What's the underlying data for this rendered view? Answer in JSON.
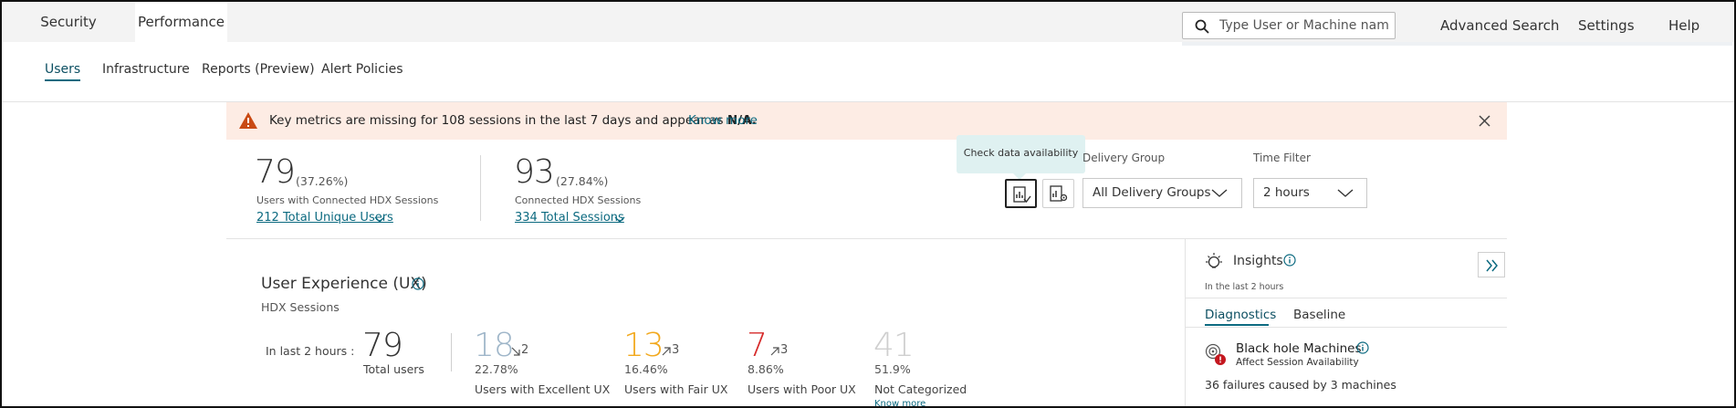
{
  "top_tabs": [
    {
      "label": "Security",
      "active": false
    },
    {
      "label": "Performance",
      "active": true
    }
  ],
  "search": {
    "placeholder": "Type User or Machine name"
  },
  "top_links": {
    "advanced_search": "Advanced Search",
    "settings": "Settings",
    "help": "Help"
  },
  "subnav": [
    {
      "label": "Users",
      "active": true
    },
    {
      "label": "Infrastructure",
      "active": false
    },
    {
      "label": "Reports (Preview)",
      "active": false
    },
    {
      "label": "Alert Policies",
      "active": false
    }
  ],
  "alert": {
    "text_before": "Key metrics are missing for 108 sessions in the last 7 days and appear as ",
    "text_bold": "N/A.",
    "link": "Know more",
    "icon": "warning-icon",
    "color": "#fdece4"
  },
  "stats": {
    "users": {
      "value": "79",
      "pct": "(37.26%)",
      "label": "Users with Connected HDX Sessions",
      "link": "212 Total Unique Users"
    },
    "sessions": {
      "value": "93",
      "pct": "(27.84%)",
      "label": "Connected HDX Sessions",
      "link": "334 Total Sessions"
    }
  },
  "tooltip": "Check data availability",
  "filters": {
    "delivery_group": {
      "label": "Delivery Group",
      "value": "All Delivery Groups"
    },
    "time_filter": {
      "label": "Time Filter",
      "value": "2 hours"
    }
  },
  "ux": {
    "title": "User Experience (UX)",
    "subtitle": "HDX Sessions",
    "period_label": "In last 2 hours :",
    "total": {
      "value": "79",
      "label": "Total users"
    },
    "excellent": {
      "value": "18",
      "delta": "2",
      "pct": "22.78%",
      "label": "Users with Excellent UX",
      "color": "#9fb6c9"
    },
    "fair": {
      "value": "13",
      "delta": "3",
      "pct": "16.46%",
      "label": "Users with Fair UX",
      "color": "#f2a91e"
    },
    "poor": {
      "value": "7",
      "delta": "3",
      "pct": "8.86%",
      "label": "Users with Poor UX",
      "color": "#d62a2a"
    },
    "not_categorized": {
      "value": "41",
      "pct": "51.9%",
      "label": "Not Categorized",
      "link": "Know more",
      "color": "#cfcfcf"
    }
  },
  "insights": {
    "title": "Insights",
    "subtitle": "In the last 2 hours",
    "tabs": [
      {
        "label": "Diagnostics",
        "active": true
      },
      {
        "label": "Baseline",
        "active": false
      }
    ],
    "item": {
      "title": "Black hole Machines",
      "subtitle": "Affect Session Availability",
      "detail": "36 failures caused by 3 machines"
    }
  }
}
